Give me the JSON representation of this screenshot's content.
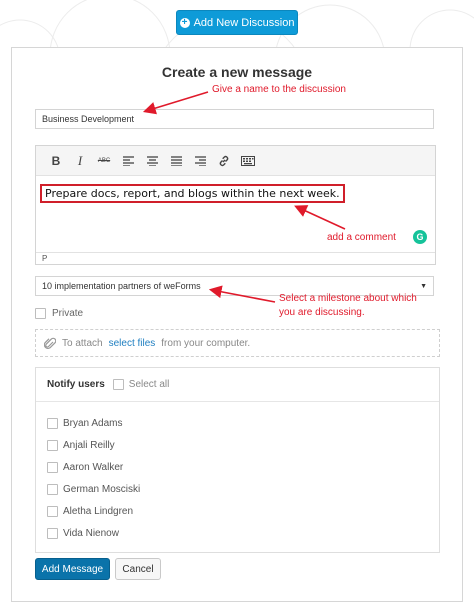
{
  "header": {
    "add_discussion_label": "Add New Discussion"
  },
  "form": {
    "title": "Create a new message",
    "title_value": "Business Development",
    "editor": {
      "toolbar": [
        {
          "name": "bold-icon",
          "glyph": "B"
        },
        {
          "name": "italic-icon",
          "glyph": "I"
        },
        {
          "name": "strikethrough-icon",
          "glyph": "ABC"
        },
        {
          "name": "align-left-icon"
        },
        {
          "name": "align-center-icon"
        },
        {
          "name": "align-justify-icon"
        },
        {
          "name": "align-right-icon"
        },
        {
          "name": "link-icon"
        },
        {
          "name": "keyboard-icon"
        }
      ],
      "content": "Prepare docs, report, and blogs within the next week.",
      "status_path": "P"
    },
    "milestone_value": "10 implementation partners of weForms",
    "private_label": "Private",
    "attach": {
      "prefix": "To attach",
      "link": "select files",
      "suffix": "from your computer."
    },
    "notify": {
      "title": "Notify users",
      "select_all": "Select all",
      "users": [
        "Bryan Adams",
        "Anjali Reilly",
        "Aaron Walker",
        "German Mosciski",
        "Aletha Lindgren",
        "Vida Nienow"
      ]
    },
    "submit_label": "Add Message",
    "cancel_label": "Cancel"
  },
  "annotations": {
    "name_hint": "Give a name to the discussion",
    "comment_hint": "add a comment",
    "milestone_hint_1": "Select a milestone about which",
    "milestone_hint_2": "you are discussing."
  },
  "colors": {
    "accent": "#0e9bd8",
    "primary_button": "#0a73aa",
    "annotation": "#e01a2b",
    "link": "#1f7fc1"
  }
}
